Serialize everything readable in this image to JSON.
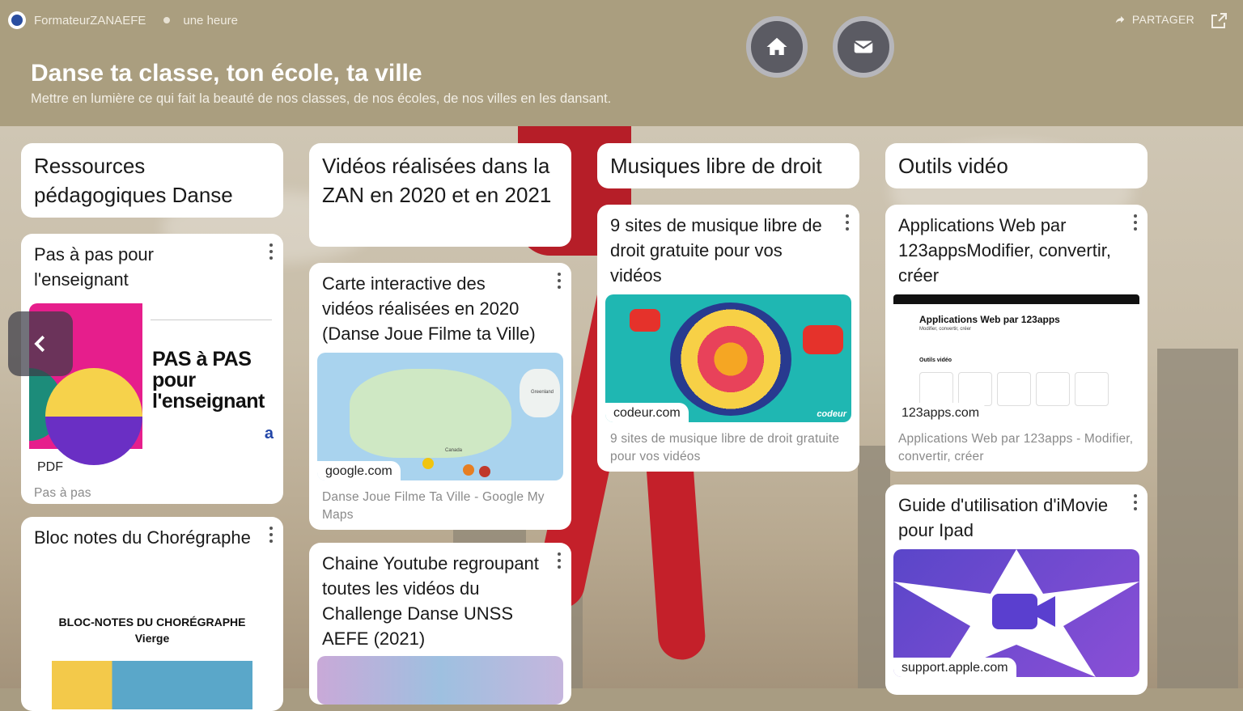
{
  "header": {
    "author": "FormateurZANAEFE",
    "time": "une heure",
    "title": "Danse ta classe, ton école, ta ville",
    "subtitle": "Mettre en lumière ce qui fait la beauté de nos classes, de nos écoles, de nos villes en les dansant.",
    "share_label": "PARTAGER",
    "home_icon": "home-icon",
    "mail_icon": "mail-icon"
  },
  "columns": [
    {
      "title": "Ressources pédagogiques Danse",
      "cards": [
        {
          "title": "Pas à pas pour l'enseignant",
          "chip": "PDF",
          "desc": "Pas à pas",
          "preview_text": "PAS à PAS pour l'enseignant"
        },
        {
          "title": "Bloc notes du Chorégraphe",
          "preview_line1": "BLOC-NOTES DU CHORÉGRAPHE",
          "preview_line2": "Vierge"
        }
      ]
    },
    {
      "title": "Vidéos réalisées dans la ZAN en 2020 et en 2021",
      "cards": [
        {
          "title": "Carte interactive des vidéos réalisées en 2020 (Danse Joue Filme ta Ville)",
          "chip": "google.com",
          "desc": "Danse Joue Filme Ta Ville - Google My Maps",
          "map_label": "Greenland",
          "map_label2": "Canada"
        },
        {
          "title": "Chaine Youtube regroupant toutes les vidéos du Challenge Danse UNSS AEFE (2021)"
        }
      ]
    },
    {
      "title": "Musiques libre de droit",
      "cards": [
        {
          "title": "9 sites de musique libre de droit gratuite pour vos vidéos",
          "chip": "codeur.com",
          "desc": "9 sites de musique libre de droit gratuite pour vos vidéos",
          "brand": "codeur"
        }
      ]
    },
    {
      "title": "Outils vidéo",
      "cards": [
        {
          "title": "Applications Web par 123appsModifier, convertir, créer",
          "chip": "123apps.com",
          "desc": "Applications Web par 123apps - Modifier, convertir, créer",
          "preview_title": "Applications Web par 123apps",
          "preview_sub": "Modifier, convertir, créer",
          "preview_section": "Outils vidéo"
        },
        {
          "title": "Guide d'utilisation d'iMovie pour Ipad",
          "chip": "support.apple.com"
        }
      ]
    }
  ],
  "colors": {
    "header_bg": "#aa9e7f",
    "card_bg": "#ffffff",
    "round_button": "#5b5b63"
  }
}
